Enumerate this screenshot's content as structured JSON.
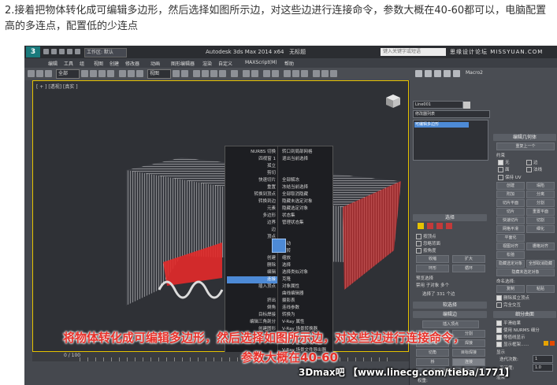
{
  "caption": "2.接着把物体转化成可编辑多边形，然后选择如图所示边，对这些边进行连接命令，参数大概在40-60都可以，电脑配置高的多连点，配置低的少连点",
  "app": {
    "logo": "3",
    "workspace": "工作区: 默认",
    "title": "Autodesk 3ds Max  2014 x64",
    "file": "无标题",
    "search_placeholder": "键入关键字或短语",
    "site": "思缘设计论坛  MISSYUAN.COM"
  },
  "menu": [
    "编辑",
    "工具",
    "组",
    "视图",
    "创建",
    "修改器",
    "动画",
    "图形编辑器",
    "渲染",
    "自定义",
    "MAXScript(M)",
    "帮助"
  ],
  "toolbar": {
    "filter": "全部",
    "view": "视图",
    "right_label": "Macro2"
  },
  "viewport": {
    "label": "[ + ] [透视] [真实 ]"
  },
  "quad": {
    "left": [
      "NURBS 切换",
      "四视窗 1",
      "孤立",
      "剪切",
      "快速切片",
      "重置",
      "转换到顶点",
      "转换到边",
      "元素",
      "多边形",
      "边界",
      "边",
      "顶点",
      "",
      "",
      "创建",
      "删除",
      "编辑",
      "连接",
      "插入顶点",
      "",
      "挤出",
      "倒角",
      "目标焊接",
      "编辑三角剖分",
      "创建图形"
    ],
    "right": [
      "转口到局部网格",
      "退出当前选择",
      "",
      "",
      "全部解冻",
      "冻结当前选择",
      "全部取消隐藏",
      "隐藏未选定对象",
      "隐藏选定对象",
      "状态集",
      "管理状态集",
      "",
      "",
      "移动",
      "旋转",
      "缩放",
      "选择",
      "选择类似对象",
      "克隆",
      "对象属性",
      "曲线编辑器",
      "摄影表",
      "连线参数",
      "转换为",
      "V-Ray 属性",
      "V-Ray 场景转换器",
      "V-Ray 网格导出",
      "V-Ray 虚拟帧缓冲区",
      "V-Ray 场景文件导出器",
      "V-Ray 动画场景导出器"
    ],
    "highlight": "连接"
  },
  "timeline": {
    "range": "0 / 100"
  },
  "panel": {
    "object_name": "Line001",
    "modifier_list": "修改器列表",
    "stack_item": "可编辑多边形",
    "edit_geometry": "编辑几何体",
    "repeat_last": "重复上一个",
    "constraints": "约束",
    "constraint_opts": [
      "无",
      "边",
      "面",
      "法线"
    ],
    "preserve_uv": "保持 UV",
    "create": "创建",
    "collapse": "塌陷",
    "attach": "附加",
    "detach": "分离",
    "slice_plane": "切片平面",
    "split": "分割",
    "slice": "切片",
    "reset_plane": "重置平面",
    "quickslice": "快速切片",
    "cut": "切割",
    "meshsmooth": "网格平滑",
    "tessellate": "细化",
    "planarize": "平面化",
    "view_align": "视图对齐",
    "grid_align": "栅格对齐",
    "relax": "松弛",
    "hide_selected": "隐藏选定对象",
    "unhide_all": "全部取消隐藏",
    "hide_unselected": "隐藏未选定对象",
    "named_sel": "命名选择:",
    "copy": "复制",
    "paste": "粘贴",
    "delete_isolated": "删除孤立顶点",
    "full_interactivity": "完全交互",
    "selection": "选择",
    "by_vertex": "按顶点",
    "ignore_backfacing": "忽略背面",
    "by_angle": "按角度",
    "shrink": "收缩",
    "grow": "扩大",
    "ring": "环形",
    "loop": "循环",
    "preview_sel": "预览选择",
    "disabled": "禁用",
    "subobj": "子对象",
    "multi": "多个",
    "selected_count": "选择了 331 个边",
    "soft_selection": "软选择",
    "edit_edges": "编辑边",
    "insert_vertex": "插入顶点",
    "remove": "移除",
    "split_edge": "分割",
    "extrude": "挤出",
    "weld": "焊接",
    "chamfer": "切角",
    "target_weld": "目标焊接",
    "bridge": "桥",
    "connect": "连接",
    "create_shape": "利用所选内容创建图形",
    "weight": "权重:",
    "crease": "折缝:",
    "subdiv_surface": "细分曲面",
    "smooth_result": "平滑结果",
    "use_nurms": "使用 NURMS 细分",
    "isoline": "等值线显示",
    "show_cage": "显示框架......",
    "display": "显示",
    "iterations": "迭代次数:",
    "iterations_val": "1",
    "smoothness": "平滑度:",
    "smoothness_val": "1.0",
    "render": "渲染",
    "sep_by": "分隔方式",
    "smoothing_groups": "平滑组",
    "materials": "材质",
    "update_opts": "更新选项",
    "always": "始终",
    "when_render": "渲染时",
    "manually": "手动",
    "update": "更新"
  },
  "overlay": {
    "line1": "将物体转化成可编辑多边形，然后选择如图所示边，对这些边进行连接命令，",
    "line2": "参数大概在40-60"
  },
  "watermark": "3Dmax吧 【www.linecg.com/tieba/1771】",
  "colors": {
    "selection": "#e42a2a",
    "highlight": "#4d8ad6",
    "accent": "#e6c200",
    "overlay_text": "#e8312a"
  }
}
